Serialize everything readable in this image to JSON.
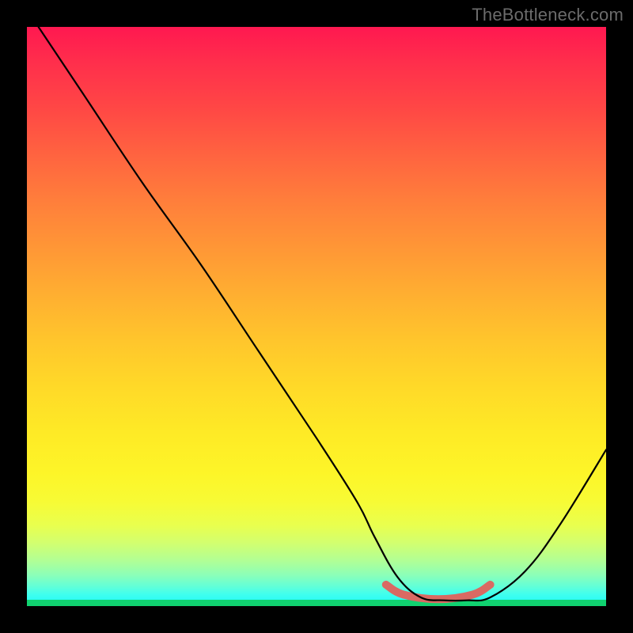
{
  "watermark": "TheBottleneck.com",
  "colors": {
    "bg": "#000000",
    "curve": "#000000",
    "highlight": "#d96a63",
    "green_band": "#10d270"
  },
  "chart_data": {
    "type": "line",
    "title": "",
    "xlabel": "",
    "ylabel": "",
    "xlim": [
      0,
      100
    ],
    "ylim": [
      0,
      100
    ],
    "x": [
      2,
      10,
      20,
      30,
      40,
      50,
      57,
      60,
      64,
      68,
      72,
      76,
      80,
      86,
      92,
      100
    ],
    "values": [
      100,
      88,
      73,
      59,
      44,
      29,
      18,
      12,
      5,
      1.5,
      1,
      1,
      1.5,
      6,
      14,
      27
    ],
    "highlight_range_x": [
      62,
      80
    ],
    "highlight_y_approx": 1.2
  }
}
